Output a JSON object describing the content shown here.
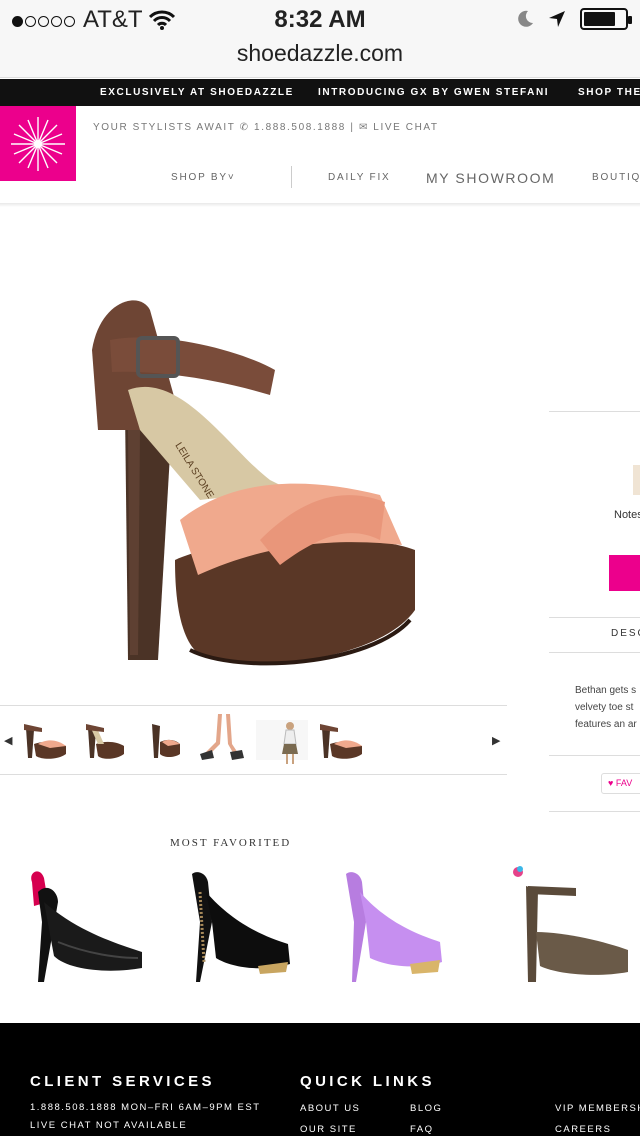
{
  "status_bar": {
    "carrier": "AT&T",
    "time": "8:32 AM",
    "url": "shoedazzle.com",
    "battery_level": 0.78
  },
  "promo": {
    "items": [
      "EXCLUSIVELY AT SHOEDAZZLE",
      "INTRODUCING GX BY GWEN STEFANI",
      "SHOP THE"
    ]
  },
  "header": {
    "stylists": "YOUR STYLISTS AWAIT",
    "phone": "1.888.508.1888",
    "separator": "|",
    "live_chat": "LIVE CHAT",
    "nav": {
      "shop_by": "SHOP BY",
      "daily_fix": "DAILY FIX",
      "my_showroom": "MY SHOWROOM",
      "boutique": "BOUTIQU"
    }
  },
  "product": {
    "brand_on_insole": "LEILA STONE",
    "notes": "Notes",
    "description_heading": "DESC",
    "description_lines": [
      "Bethan gets s",
      "velvety toe st",
      "features an ar"
    ],
    "favorite": "FAV"
  },
  "thumbnails": {
    "prev": "◀",
    "next": "▶",
    "count": 6
  },
  "most_favorited": {
    "title": "MOST FAVORITED"
  },
  "footer": {
    "client_services": "CLIENT SERVICES",
    "phone_hours": "1.888.508.1888 MON–FRI 6AM–9PM EST",
    "live_chat": "LIVE CHAT NOT AVAILABLE",
    "quick_links": "QUICK LINKS",
    "links": {
      "about_us": "ABOUT US",
      "blog": "BLOG",
      "our_site": "OUR SITE",
      "faq": "FAQ",
      "vip": "VIP MEMBERSH",
      "careers": "CAREERS"
    }
  },
  "colors": {
    "brand_pink": "#ec008c",
    "promo_bg": "#111111",
    "footer_bg": "#000000"
  }
}
